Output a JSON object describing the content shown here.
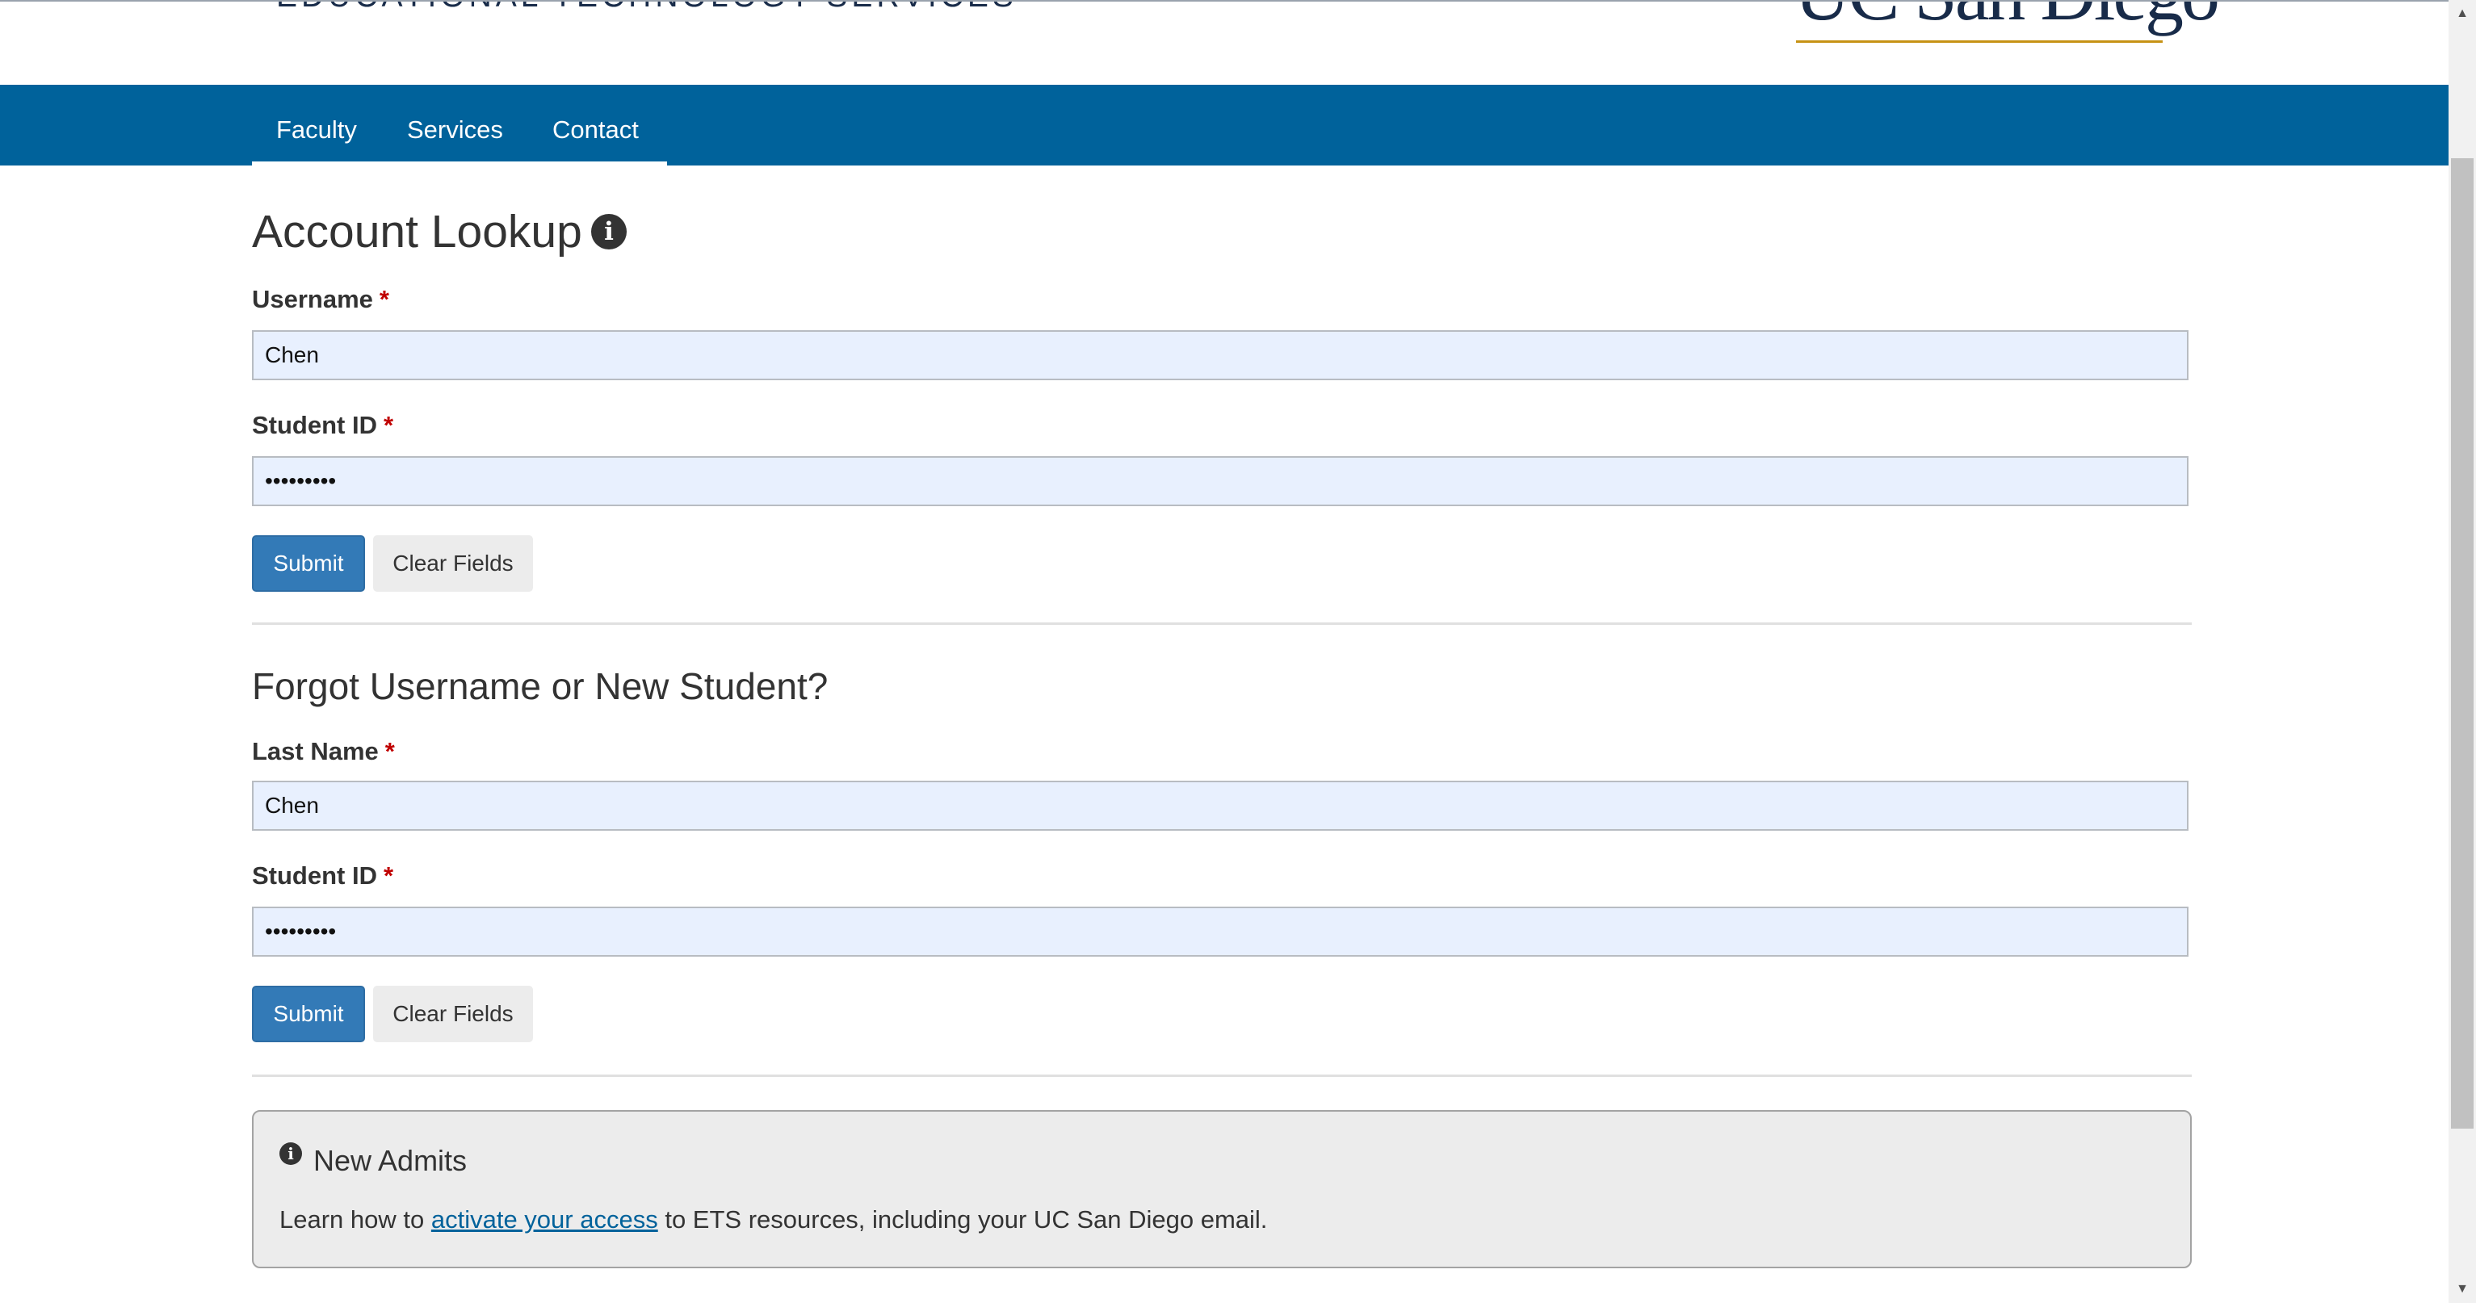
{
  "header": {
    "department": "EDUCATIONAL TECHNOLOGY SERVICES",
    "logo_text": "UC San Diego"
  },
  "nav": {
    "items": [
      {
        "label": "Faculty"
      },
      {
        "label": "Services"
      },
      {
        "label": "Contact"
      }
    ]
  },
  "account_lookup": {
    "title": "Account Lookup",
    "username_label": "Username",
    "username_value": "Chen",
    "student_id_label": "Student ID",
    "student_id_value": "123456789",
    "submit_label": "Submit",
    "clear_label": "Clear Fields"
  },
  "forgot": {
    "title": "Forgot Username or New Student?",
    "last_name_label": "Last Name",
    "last_name_value": "Chen",
    "student_id_label": "Student ID",
    "student_id_value": "123456789",
    "submit_label": "Submit",
    "clear_label": "Clear Fields"
  },
  "required_marker": "*",
  "notice": {
    "title": "New Admits",
    "text_before": "Learn how to ",
    "link_text": "activate your access",
    "text_after": " to ETS resources, including your UC San Diego email."
  },
  "colors": {
    "nav_bg": "#00629b",
    "primary_button": "#337ab7",
    "required": "#c00000",
    "input_bg": "#e8f0fe"
  },
  "icons": {
    "info": "info-circle-icon",
    "scroll_up": "scroll-up-arrow-icon",
    "scroll_down": "scroll-down-arrow-icon"
  }
}
